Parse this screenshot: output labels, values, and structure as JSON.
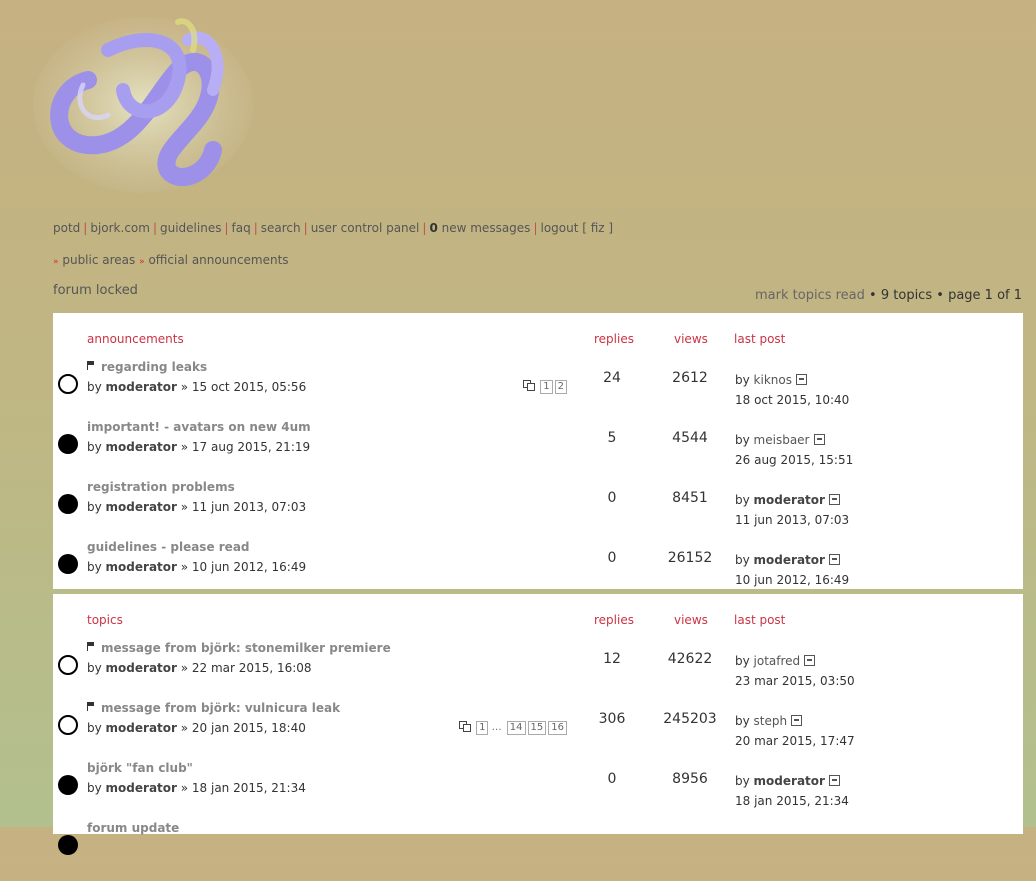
{
  "nav": {
    "items": [
      "potd",
      "bjork.com",
      "guidelines",
      "faq",
      "search",
      "user control panel"
    ],
    "new_count": "0",
    "new_label": "new messages",
    "logout": "logout [ fiz ]"
  },
  "breadcrumbs": [
    "public areas",
    "official announcements"
  ],
  "locked": "forum locked",
  "pagination": {
    "mark_read": "mark topics read",
    "bullet": "•",
    "topics": "9 topics",
    "page": "page 1 of 1"
  },
  "headers": {
    "announcements": "announcements",
    "topics": "topics",
    "replies": "replies",
    "views": "views",
    "last_post": "last post"
  },
  "announcements": [
    {
      "title": "regarding leaks",
      "sticky": true,
      "by": "by",
      "author": "moderator",
      "date": "» 15 oct 2015, 05:56",
      "pages": [
        "1",
        "2"
      ],
      "replies": "24",
      "views": "2612",
      "last_by": "by",
      "last_user": "kiknos",
      "last_bold": false,
      "last_date": "18 oct 2015, 10:40",
      "read": true
    },
    {
      "title": "important! - avatars on new 4um",
      "sticky": false,
      "by": "by",
      "author": "moderator",
      "date": "» 17 aug 2015, 21:19",
      "pages": [],
      "replies": "5",
      "views": "4544",
      "last_by": "by",
      "last_user": "meisbaer",
      "last_bold": false,
      "last_date": "26 aug 2015, 15:51",
      "read": false
    },
    {
      "title": "registration problems",
      "sticky": false,
      "by": "by",
      "author": "moderator",
      "date": "» 11 jun 2013, 07:03",
      "pages": [],
      "replies": "0",
      "views": "8451",
      "last_by": "by",
      "last_user": "moderator",
      "last_bold": true,
      "last_date": "11 jun 2013, 07:03",
      "read": false
    },
    {
      "title": "guidelines - please read",
      "sticky": false,
      "by": "by",
      "author": "moderator",
      "date": "» 10 jun 2012, 16:49",
      "pages": [],
      "replies": "0",
      "views": "26152",
      "last_by": "by",
      "last_user": "moderator",
      "last_bold": true,
      "last_date": "10 jun 2012, 16:49",
      "read": false
    }
  ],
  "topics": [
    {
      "title": "message from björk: stonemilker premiere",
      "sticky": true,
      "by": "by",
      "author": "moderator",
      "date": "» 22 mar 2015, 16:08",
      "pages": [],
      "replies": "12",
      "views": "42622",
      "last_by": "by",
      "last_user": "jotafred",
      "last_bold": false,
      "last_date": "23 mar 2015, 03:50",
      "read": true
    },
    {
      "title": "message from björk: vulnicura leak",
      "sticky": true,
      "by": "by",
      "author": "moderator",
      "date": "» 20 jan 2015, 18:40",
      "pages": [
        "1",
        "...",
        "14",
        "15",
        "16"
      ],
      "replies": "306",
      "views": "245203",
      "last_by": "by",
      "last_user": "steph",
      "last_bold": false,
      "last_date": "20 mar 2015, 17:47",
      "read": true
    },
    {
      "title": "björk \"fan club\"",
      "sticky": false,
      "by": "by",
      "author": "moderator",
      "date": "» 18 jan 2015, 21:34",
      "pages": [],
      "replies": "0",
      "views": "8956",
      "last_by": "by",
      "last_user": "moderator",
      "last_bold": true,
      "last_date": "18 jan 2015, 21:34",
      "read": false
    },
    {
      "title": "forum update",
      "sticky": false,
      "by": "",
      "author": "",
      "date": "",
      "pages": [],
      "replies": "",
      "views": "",
      "last_by": "",
      "last_user": "",
      "last_bold": false,
      "last_date": "",
      "read": false
    }
  ]
}
